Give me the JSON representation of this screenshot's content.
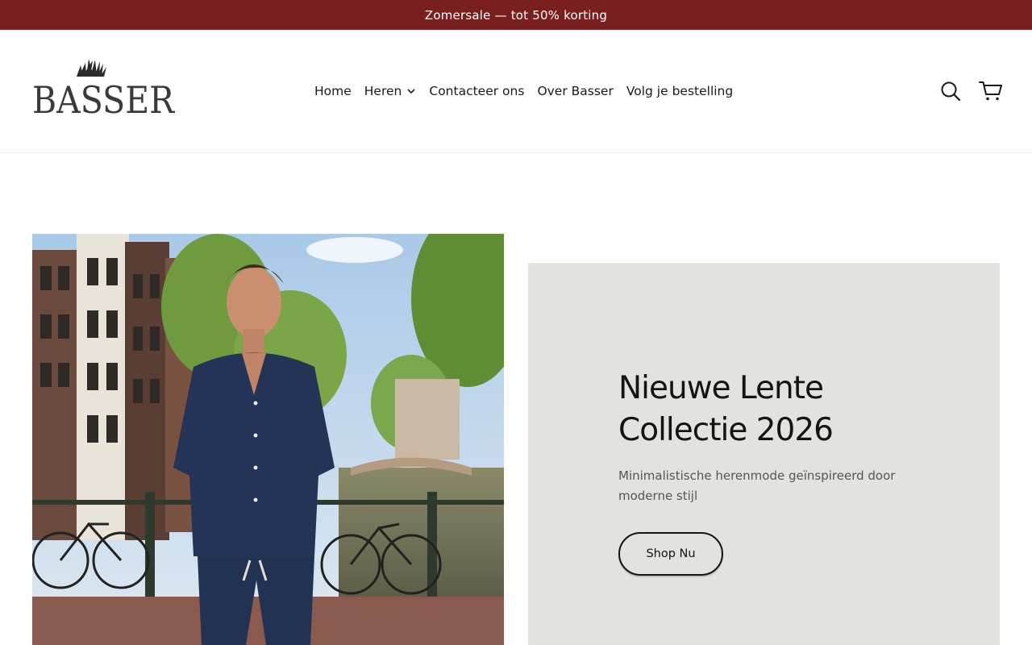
{
  "announcement": {
    "text": "Zomersale — tot 50% korting"
  },
  "brand": {
    "name": "BASSER"
  },
  "nav": {
    "items": [
      {
        "label": "Home"
      },
      {
        "label": "Heren",
        "has_dropdown": true
      },
      {
        "label": "Contacteer ons"
      },
      {
        "label": "Over Basser"
      },
      {
        "label": "Volg je bestelling"
      }
    ]
  },
  "header_icons": {
    "search": "search-icon",
    "cart": "cart-icon"
  },
  "hero": {
    "title_line1": "Nieuwe Lente",
    "title_line2": "Collectie 2026",
    "subtitle": "Minimalistische herenmode geïnspireerd door moderne stijl",
    "cta_label": "Shop Nu"
  },
  "colors": {
    "announcement_bg": "#7a1f20",
    "hero_panel_bg": "#e2e2de",
    "text_dark": "#141414"
  }
}
